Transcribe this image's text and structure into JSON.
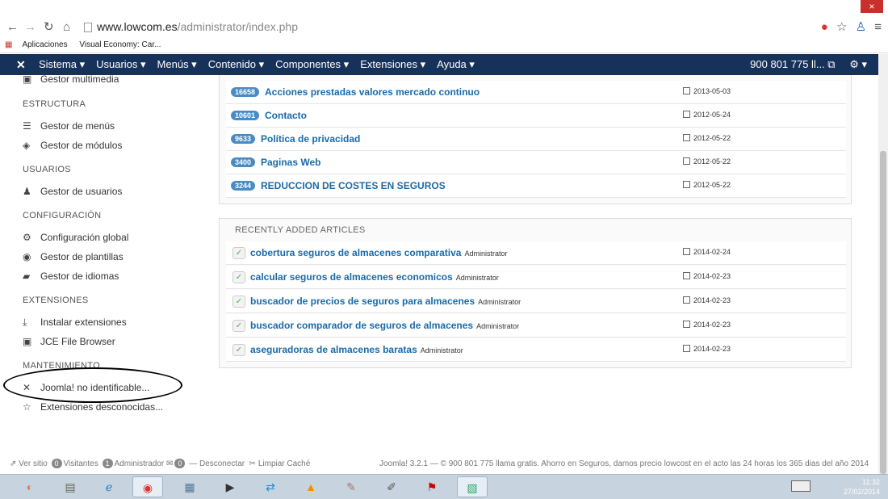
{
  "browser": {
    "url_host": "www.lowcom.es",
    "url_path": "/administrator/index.php",
    "bookmarks": [
      "Aplicaciones",
      "Visual Economy: Car..."
    ],
    "close_glyph": "×"
  },
  "navbar": {
    "logo": "✕",
    "menus": [
      "Sistema ▾",
      "Usuarios ▾",
      "Menús ▾",
      "Contenido ▾",
      "Componentes ▾",
      "Extensiones ▾",
      "Ayuda ▾"
    ],
    "site_label": "900 801 775 ll... ⧉",
    "gear": "⚙ ▾"
  },
  "sidebar": {
    "top_item": "Gestor multimedia",
    "sections": [
      {
        "heading": "ESTRUCTURA",
        "items": [
          {
            "icon": "list-icon",
            "label": "Gestor de menús"
          },
          {
            "icon": "cube-icon",
            "label": "Gestor de módulos"
          }
        ]
      },
      {
        "heading": "USUARIOS",
        "items": [
          {
            "icon": "users-icon",
            "label": "Gestor de usuarios"
          }
        ]
      },
      {
        "heading": "CONFIGURACIÓN",
        "items": [
          {
            "icon": "gear-icon",
            "label": "Configuración global"
          },
          {
            "icon": "eye-icon",
            "label": "Gestor de plantillas"
          },
          {
            "icon": "comments-icon",
            "label": "Gestor de idiomas"
          }
        ]
      },
      {
        "heading": "EXTENSIONES",
        "items": [
          {
            "icon": "download-icon",
            "label": "Instalar extensiones"
          },
          {
            "icon": "image-icon",
            "label": "JCE File Browser"
          }
        ]
      },
      {
        "heading": "MANTENIMIENTO",
        "items": [
          {
            "icon": "joomla-icon",
            "label": "Joomla! no identificable..."
          },
          {
            "icon": "star-icon",
            "label": "Extensiones desconocidas..."
          }
        ]
      }
    ]
  },
  "popular": [
    {
      "hits": "16658",
      "title": "Acciones prestadas valores mercado continuo",
      "date": "2013-05-03"
    },
    {
      "hits": "10601",
      "title": "Contacto",
      "date": "2012-05-24"
    },
    {
      "hits": "9633",
      "title": "Política de privacidad",
      "date": "2012-05-22"
    },
    {
      "hits": "3400",
      "title": "Paginas Web",
      "date": "2012-05-22"
    },
    {
      "hits": "3244",
      "title": "REDUCCION DE COSTES EN SEGUROS",
      "date": "2012-05-22"
    }
  ],
  "recent": {
    "heading": "RECENTLY ADDED ARTICLES",
    "rows": [
      {
        "title": "cobertura seguros de almacenes comparativa",
        "author": "Administrator",
        "date": "2014-02-24"
      },
      {
        "title": "calcular seguros de almacenes economicos",
        "author": "Administrator",
        "date": "2014-02-23"
      },
      {
        "title": "buscador de precios de seguros para almacenes",
        "author": "Administrator",
        "date": "2014-02-23"
      },
      {
        "title": "buscador comparador de seguros de almacenes",
        "author": "Administrator",
        "date": "2014-02-23"
      },
      {
        "title": "aseguradoras de almacenes baratas",
        "author": "Administrator",
        "date": "2014-02-23"
      }
    ]
  },
  "status": {
    "view_site": "⇗ Ver sitio",
    "visitors_count": "0",
    "visitors_label": "Visitantes",
    "admins_count": "1",
    "admins_label": "Administrador",
    "messages_count": "0",
    "logout": "— Desconectar",
    "clear_cache": "✂ Limpiar Caché",
    "copyright": "Joomla! 3.2.1 — © 900 801 775 llama gratis. Ahorro en Seguros, damos precio lowcost en el acto las 24 horas los 365 dias del año 2014"
  },
  "taskbar": {
    "time": "11:32",
    "date": "27/02/2014"
  },
  "colors": {
    "navbar": "#17325a",
    "link": "#1a6aa8",
    "badge": "#4a8cc2"
  }
}
